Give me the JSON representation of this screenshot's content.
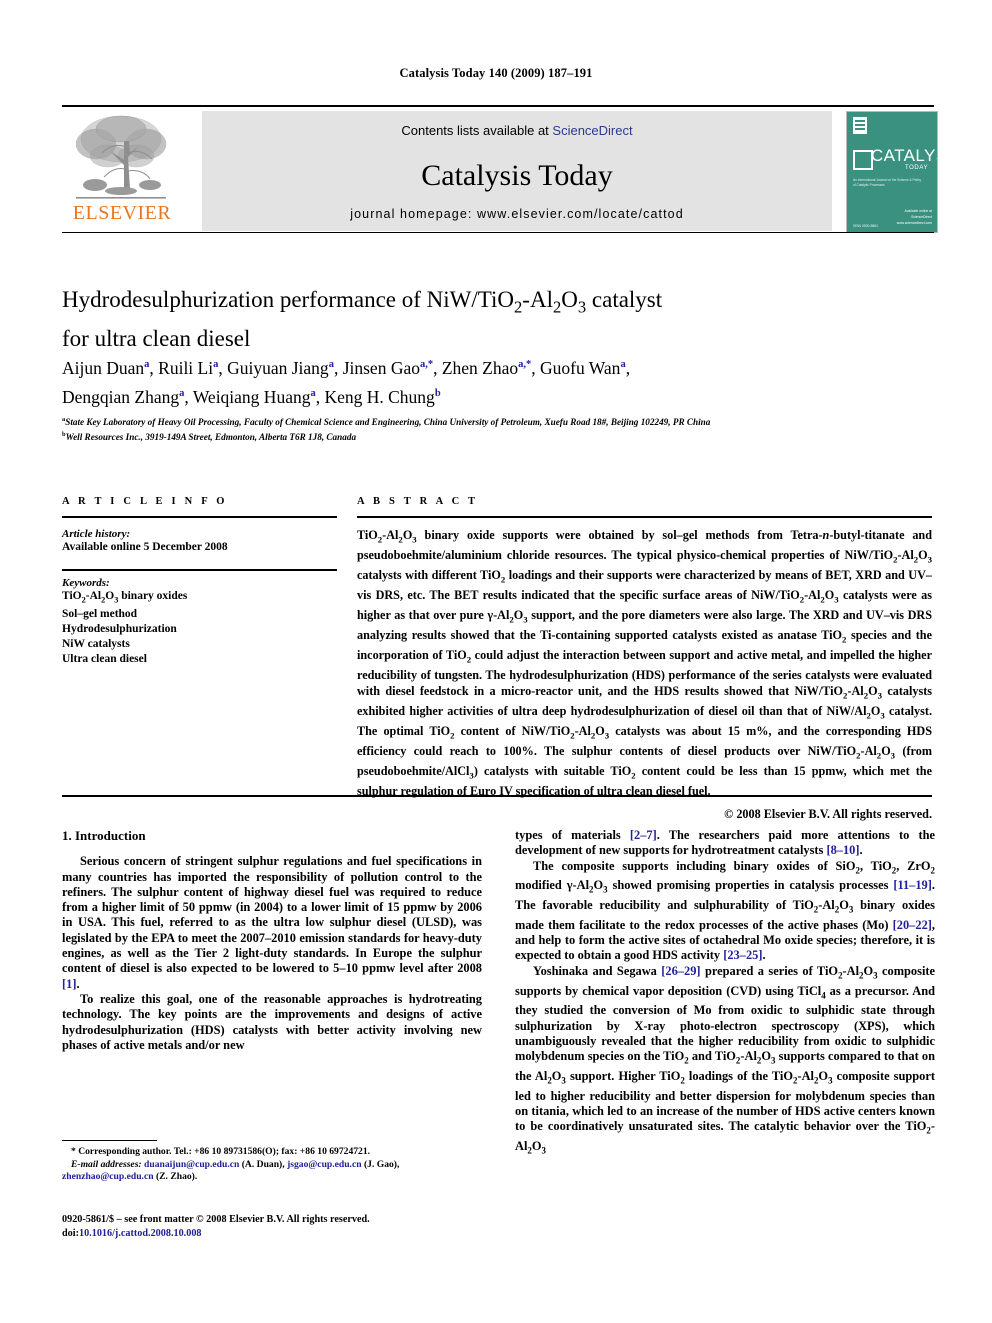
{
  "running_head": "Catalysis Today 140 (2009) 187–191",
  "banner": {
    "publisher_wordmark": "ELSEVIER",
    "contents_prefix": "Contents lists available at ",
    "contents_link": "ScienceDirect",
    "journal_title": "Catalysis Today",
    "homepage": "journal homepage: www.elsevier.com/locate/cattod",
    "cover": {
      "title": "CATALYSIS",
      "subtitle": "TODAY",
      "body_blurb": "An International Journal on the Science & Policy of Catalytic Processes",
      "issn_note": "ISSN 0920-5861",
      "foot_note": "Available online at",
      "sd_mark_1": "Available online at",
      "sd_mark_2": "ScienceDirect",
      "sd_mark_3": "www.sciencedirect.com"
    }
  },
  "article": {
    "title_line_1": "Hydrodesulphurization performance of NiW/TiO",
    "title_sub_1": "2",
    "title_mid_1": "-Al",
    "title_sub_2": "2",
    "title_mid_2": "O",
    "title_sub_3": "3",
    "title_end_1": " catalyst",
    "title_line_2": "for ultra clean diesel",
    "authors_line_1": "Aijun Duan",
    "authors_line_2": "Dengqian Zhang",
    "affiliation_a": "State Key Laboratory of Heavy Oil Processing, Faculty of Chemical Science and Engineering, China University of Petroleum, Xuefu Road 18#, Beijing 102249, PR China",
    "affiliation_b": "Well Resources Inc., 3919-149A Street, Edmonton, Alberta T6R 1J8, Canada",
    "authors": [
      {
        "name": "Aijun Duan",
        "sup": "a"
      },
      {
        "name": "Ruili Li",
        "sup": "a"
      },
      {
        "name": "Guiyuan Jiang",
        "sup": "a"
      },
      {
        "name": "Jinsen Gao",
        "sup": "a,*"
      },
      {
        "name": "Zhen Zhao",
        "sup": "a,*"
      },
      {
        "name": "Guofu Wan",
        "sup": "a"
      },
      {
        "name": "Dengqian Zhang",
        "sup": "a"
      },
      {
        "name": "Weiqiang Huang",
        "sup": "a"
      },
      {
        "name": "Keng H. Chung",
        "sup": "b"
      }
    ]
  },
  "article_info": {
    "label": "A R T I C L E   I N F O",
    "history_heading": "Article history:",
    "history_value": "Available online 5 December 2008",
    "keywords_heading": "Keywords:",
    "keywords": [
      "TiO2-Al2O3 binary oxides",
      "Sol–gel method",
      "Hydrodesulphurization",
      "NiW catalysts",
      "Ultra clean diesel"
    ]
  },
  "abstract": {
    "label": "A B S T R A C T",
    "text": "TiO2-Al2O3 binary oxide supports were obtained by sol–gel methods from Tetra-n-butyl-titanate and pseudoboehmite/aluminium chloride resources. The typical physico-chemical properties of NiW/TiO2-Al2O3 catalysts with different TiO2 loadings and their supports were characterized by means of BET, XRD and UV–vis DRS, etc. The BET results indicated that the specific surface areas of NiW/TiO2-Al2O3 catalysts were as higher as that over pure γ-Al2O3 support, and the pore diameters were also large. The XRD and UV–vis DRS analyzing results showed that the Ti-containing supported catalysts existed as anatase TiO2 species and the incorporation of TiO2 could adjust the interaction between support and active metal, and impelled the higher reducibility of tungsten. The hydrodesulphurization (HDS) performance of the series catalysts were evaluated with diesel feedstock in a micro-reactor unit, and the HDS results showed that NiW/TiO2-Al2O3 catalysts exhibited higher activities of ultra deep hydrodesulphurization of diesel oil than that of NiW/Al2O3 catalyst. The optimal TiO2 content of NiW/TiO2-Al2O3 catalysts was about 15 m%, and the corresponding HDS efficiency could reach to 100%. The sulphur contents of diesel products over NiW/TiO2-Al2O3 (from pseudoboehmite/AlCl3) catalysts with suitable TiO2 content could be less than 15 ppmw, which met the sulphur regulation of Euro IV specification of ultra clean diesel fuel.",
    "copyright": "© 2008 Elsevier B.V. All rights reserved."
  },
  "body": {
    "section_heading": "1. Introduction",
    "left_p1": "Serious concern of stringent sulphur regulations and fuel specifications in many countries has imported the responsibility of pollution control to the refiners. The sulphur content of highway diesel fuel was required to reduce from a higher limit of 50 ppmw (in 2004) to a lower limit of 15 ppmw by 2006 in USA. This fuel, referred to as the ultra low sulphur diesel (ULSD), was legislated by the EPA to meet the 2007–2010 emission standards for heavy-duty engines, as well as the Tier 2 light-duty standards. In Europe the sulphur content of diesel is also expected to be lowered to 5–10 ppmw level after 2008 ",
    "left_p1_ref": "[1]",
    "left_p1_tail": ".",
    "left_p2": "To realize this goal, one of the reasonable approaches is hydrotreating technology. The key points are the improvements and designs of active hydrodesulphurization (HDS) catalysts with better activity involving new phases of active metals and/or new",
    "right_p1_head": "types of materials ",
    "right_p1_ref1": "[2–7]",
    "right_p1_mid": ". The researchers paid more attentions to the development of new supports for hydrotreatment catalysts ",
    "right_p1_ref2": "[8–10]",
    "right_p1_tail": ".",
    "right_p2_a": "The composite supports including binary oxides of SiO2, TiO2, ZrO2 modified γ-Al2O3 showed promising properties in catalysis processes ",
    "right_p2_ref1": "[11–19]",
    "right_p2_b": ". The favorable reducibility and sulphurability of TiO2-Al2O3 binary oxides made them facilitate to the redox processes of the active phases (Mo) ",
    "right_p2_ref2": "[20–22]",
    "right_p2_c": ", and help to form the active sites of octahedral Mo oxide species; therefore, it is expected to obtain a good HDS activity ",
    "right_p2_ref3": "[23–25]",
    "right_p2_d": ".",
    "right_p3_a": "Yoshinaka and Segawa ",
    "right_p3_ref1": "[26–29]",
    "right_p3_b": " prepared a series of TiO2-Al2O3 composite supports by chemical vapor deposition (CVD) using TiCl4 as a precursor. And they studied the conversion of Mo from oxidic to sulphidic state through sulphurization by X-ray photo-electron spectroscopy (XPS), which unambiguously revealed that the higher reducibility from oxidic to sulphidic molybdenum species on the TiO2 and TiO2-Al2O3 supports compared to that on the Al2O3 support. Higher TiO2 loadings of the TiO2-Al2O3 composite support led to higher reducibility and better dispersion for molybdenum species than on titania, which led to an increase of the number of HDS active centers known to be coordinatively unsaturated sites. The catalytic behavior over the TiO2-Al2O3"
  },
  "footnote": {
    "corresponding": "Corresponding author. Tel.: +86 10 89731586(O); fax: +86 10 69724721.",
    "email_label": "E-mail addresses:",
    "email_1": "duanaijun@cup.edu.cn",
    "email_1_owner": " (A. Duan), ",
    "email_2": "jsgao@cup.edu.cn",
    "email_2_owner": " (J. Gao), ",
    "email_3": "zhenzhao@cup.edu.cn",
    "email_3_owner": " (Z. Zhao)."
  },
  "imprint": {
    "line1": "0920-5861/$ – see front matter © 2008 Elsevier B.V. All rights reserved.",
    "doi_label": "doi:",
    "doi_value": "10.1016/j.cattod.2008.10.008"
  },
  "colors": {
    "link_blue": "#20209a",
    "sciencedirect_blue": "#2b3a8f",
    "elsevier_orange": "#E87722",
    "cover_teal": "#3a9180",
    "panel_grey": "#e3e3e3"
  }
}
